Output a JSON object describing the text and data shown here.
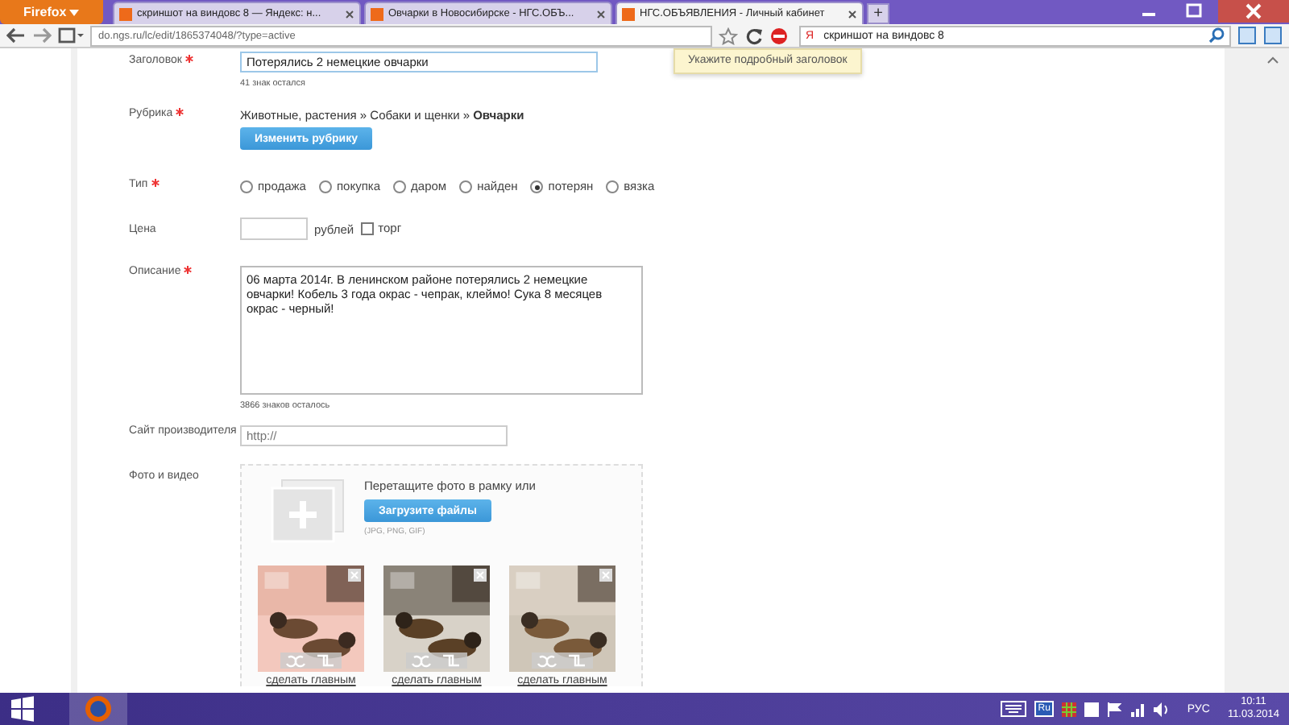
{
  "browser": {
    "menu_button": "Firefox",
    "tabs": [
      {
        "label": "скриншот на виндовс 8 — Яндекс: н...",
        "selected": false
      },
      {
        "label": "Овчарки в Новосибирске - НГС.ОБЪ...",
        "selected": false
      },
      {
        "label": "НГС.ОБЪЯВЛЕНИЯ - Личный кабинет",
        "selected": true
      }
    ],
    "new_tab": "+",
    "search_engine_badge": "Я",
    "url": "do.ngs.ru/lc/edit/1865374048/?type=active",
    "search": "скриншот на виндовс 8"
  },
  "tooltip": "Укажите подробный заголовок",
  "form": {
    "title": {
      "label": "Заголовок",
      "required": true,
      "value": "Потерялись 2 немецкие овчарки",
      "hint": "41 знак остался"
    },
    "category": {
      "label": "Рубрика",
      "required": true,
      "path": "Животные, растения » Собаки и щенки » **Овчарки**",
      "button": "Изменить рубрику"
    },
    "type": {
      "label": "Тип",
      "required": true,
      "options": [
        {
          "label": "продажа",
          "selected": false
        },
        {
          "label": "покупка",
          "selected": false
        },
        {
          "label": "даром",
          "selected": false
        },
        {
          "label": "найден",
          "selected": false
        },
        {
          "label": "потерян",
          "selected": true
        },
        {
          "label": "вязка",
          "selected": false
        }
      ]
    },
    "price": {
      "label": "Цена",
      "unit": "рублей",
      "bargain": {
        "label": "торг",
        "checked": false
      }
    },
    "description": {
      "label": "Описание",
      "required": true,
      "value": "06 марта 2014г. В ленинском районе потерялись 2 немецкие овчарки! Кобель 3 года окрас - чепрак, клеймо! Сука 8 месяцев окрас - черный!",
      "hint": "3866 знаков осталось"
    },
    "site": {
      "label": "Сайт производителя",
      "placeholder": "http://"
    },
    "media": {
      "label": "Фото и видео",
      "drop_text": "Перетащите фото в рамку или",
      "upload_button": "Загрузите файлы",
      "formats": "(JPG, PNG, GIF)",
      "photos": [
        {
          "kind": "picture",
          "link": "сделать главным"
        },
        {
          "kind": "picture",
          "link": "сделать главным"
        },
        {
          "kind": "picture",
          "link": "сделать главным"
        }
      ]
    }
  },
  "taskbar": {
    "tray_badge": "Ru",
    "language": "РУС",
    "time": "10:11",
    "date": "11.03.2014"
  }
}
